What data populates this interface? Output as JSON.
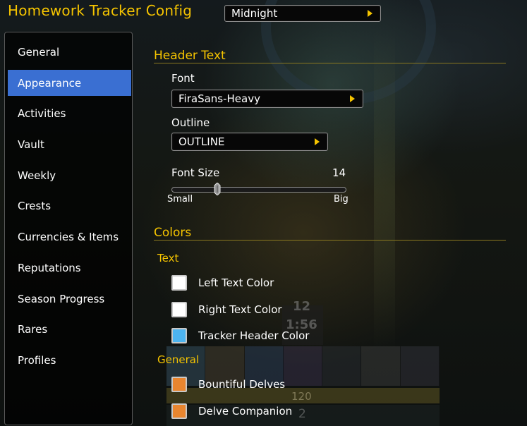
{
  "window": {
    "title": "Homework Tracker Config"
  },
  "profile_dropdown": {
    "value": "Midnight"
  },
  "sidebar": {
    "items": [
      {
        "label": "General",
        "active": false
      },
      {
        "label": "Appearance",
        "active": true
      },
      {
        "label": "Activities",
        "active": false
      },
      {
        "label": "Vault",
        "active": false
      },
      {
        "label": "Weekly",
        "active": false
      },
      {
        "label": "Crests",
        "active": false
      },
      {
        "label": "Currencies & Items",
        "active": false
      },
      {
        "label": "Reputations",
        "active": false
      },
      {
        "label": "Season Progress",
        "active": false
      },
      {
        "label": "Rares",
        "active": false
      },
      {
        "label": "Profiles",
        "active": false
      }
    ]
  },
  "header_text": {
    "heading": "Header Text",
    "font": {
      "label": "Font",
      "value": "FiraSans-Heavy"
    },
    "outline": {
      "label": "Outline",
      "value": "OUTLINE"
    },
    "font_size": {
      "label": "Font Size",
      "value": 14,
      "min_label": "Small",
      "max_label": "Big",
      "position": 0.25
    }
  },
  "colors": {
    "heading": "Colors",
    "text_group": {
      "label": "Text",
      "items": [
        {
          "label": "Left Text Color",
          "color": "#ffffff"
        },
        {
          "label": "Right Text Color",
          "color": "#ffffff"
        },
        {
          "label": "Tracker Header Color",
          "color": "#4db4f0"
        }
      ]
    },
    "general_group": {
      "label": "General",
      "items": [
        {
          "label": "Bountiful Delves",
          "color": "#e8852f"
        },
        {
          "label": "Delve Companion",
          "color": "#e8852f"
        }
      ]
    }
  },
  "icons": {
    "dropdown_arrow": "triangle-right-icon",
    "slider_thumb": "slider-thumb-icon"
  },
  "theme": {
    "accent": "#f5c400",
    "selection": "#3a6fd2"
  }
}
